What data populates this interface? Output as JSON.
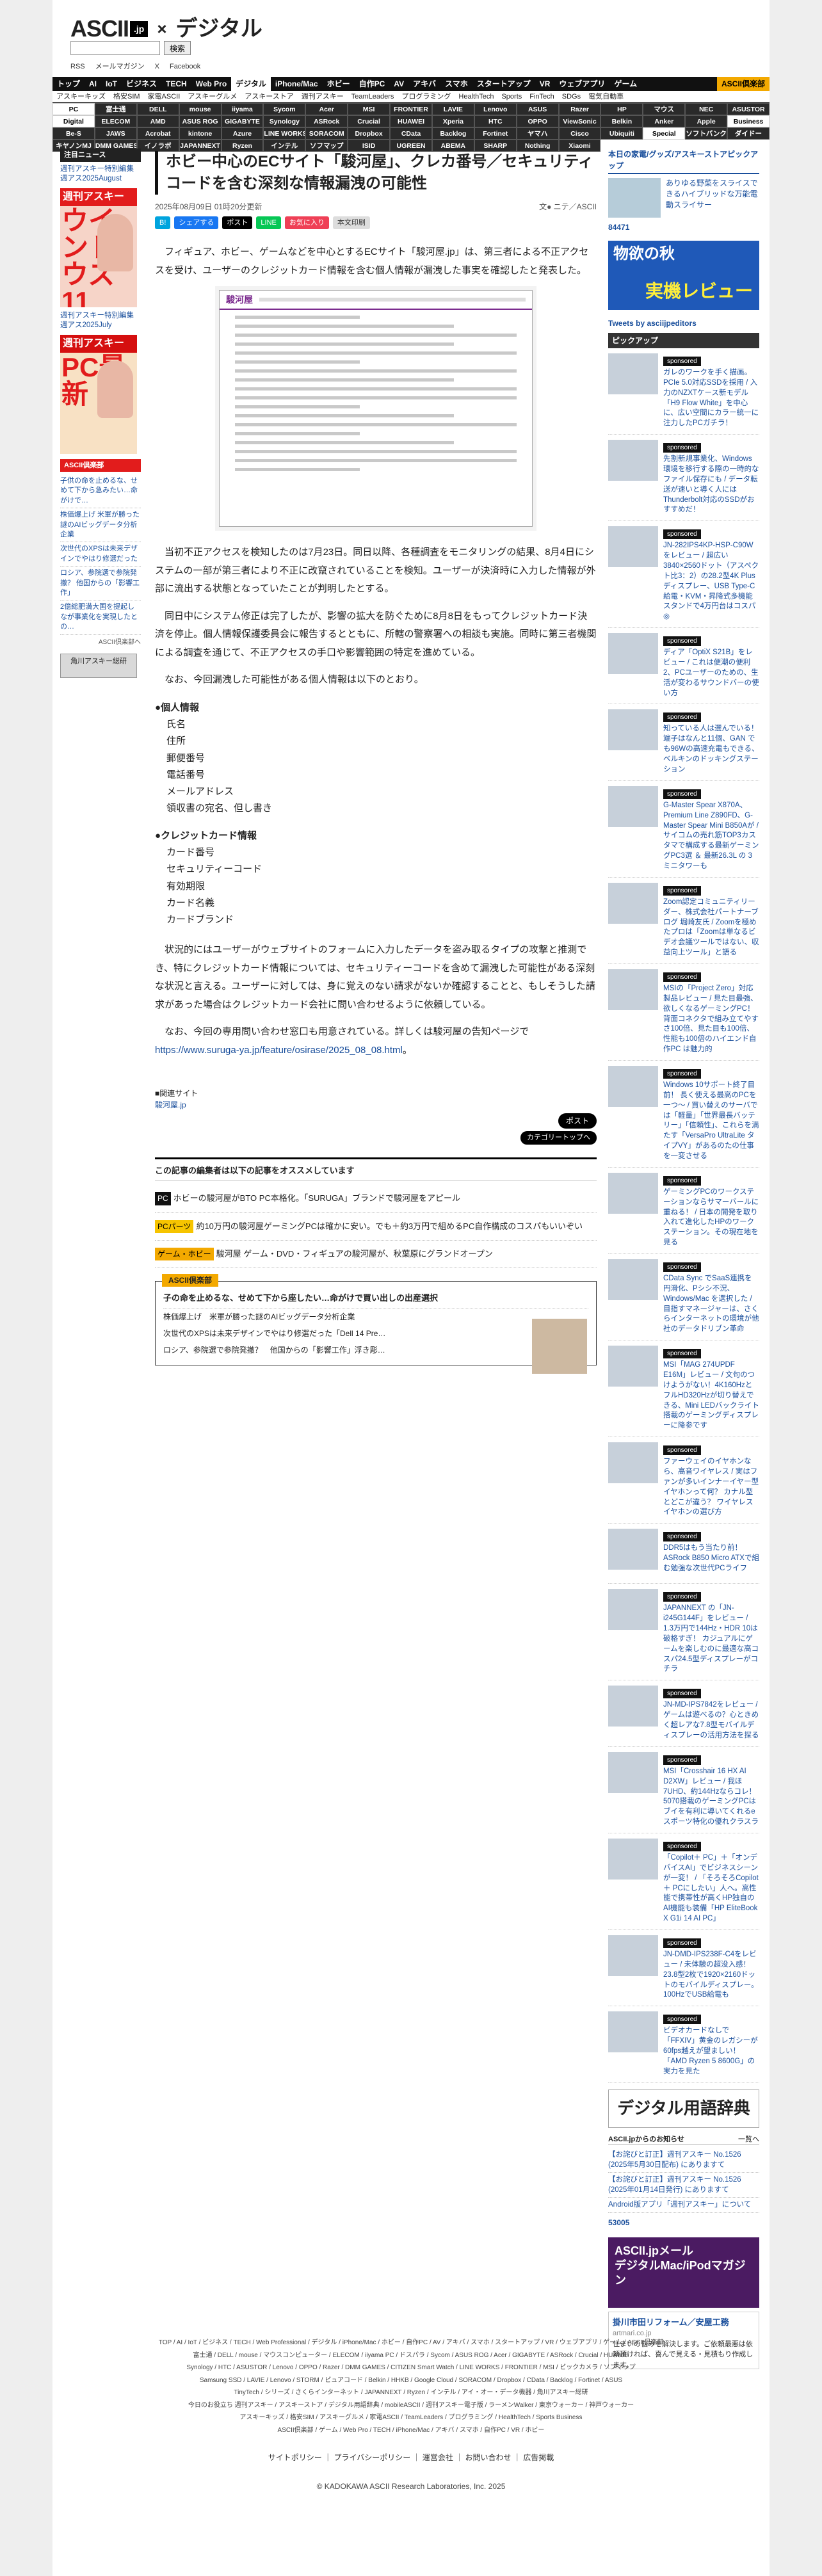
{
  "header": {
    "logo_ascii": "ASCII",
    "logo_jp": ".jp",
    "logo_x": "×",
    "logo_digital": "デジタル",
    "search_button": "検索",
    "sub_links": [
      "RSS",
      "メールマガジン",
      "X",
      "Facebook"
    ]
  },
  "nav": {
    "primary": [
      "トップ",
      "AI",
      "IoT",
      "ビジネス",
      "TECH",
      "Web Pro",
      "デジタル",
      "iPhone/Mac",
      "ホビー",
      "自作PC",
      "AV",
      "アキバ",
      "スマホ",
      "スタートアップ",
      "VR",
      "ウェブアプリ",
      "ゲーム"
    ],
    "active": "デジタル",
    "club_label": "ASCII倶楽部",
    "secondary": [
      "アスキーキッズ",
      "格安SIM",
      "家電ASCII",
      "アスキーグルメ",
      "アスキーストア",
      "週刊アスキー",
      "TeamLeaders",
      "プログラミング",
      "HealthTech",
      "Sports",
      "FinTech",
      "SDGs",
      "電気自動車"
    ],
    "grid": [
      "PC",
      "富士通",
      "DELL",
      "mouse",
      "iiyama",
      "Sycom",
      "Acer",
      "MSI",
      "FRONTIER",
      "LAVIE",
      "Lenovo",
      "ASUS",
      "Razer",
      "HP",
      "マウス",
      "NEC",
      "ASUSTOR",
      "Digital",
      "ELECOM",
      "AMD",
      "ASUS ROG",
      "GIGABYTE",
      "Synology",
      "ASRock",
      "Crucial",
      "HUAWEI",
      "Xperia",
      "HTC",
      "OPPO",
      "ViewSonic",
      "Belkin",
      "Anker",
      "Apple",
      "Business",
      "Be-S",
      "JAWS",
      "Acrobat",
      "kintone",
      "Azure",
      "LINE WORKS",
      "SORACOM",
      "Dropbox",
      "CData",
      "Backlog",
      "Fortinet",
      "ヤマハ",
      "Cisco",
      "Ubiquiti",
      "Special",
      "ソフトバンク",
      "ダイドー",
      "キヤノンMJ",
      "DMM GAMES",
      "イノラボ",
      "JAPANNEXT",
      "Ryzen",
      "インテル",
      "ソフマップ",
      "ISID",
      "UGREEN",
      "ABEMA",
      "SHARP",
      "Nothing",
      "Xiaomi"
    ]
  },
  "left": {
    "header": "注目ニュース",
    "links": [
      "週刊アスキー特別編集 週アス2025August",
      "週刊アスキー特別編集 週アス2025July"
    ],
    "mag1_title": "週刊アスキー",
    "mag1_big": "ウインドウズ11",
    "mag2_title": "週刊アスキー",
    "mag2_big": "PC最新",
    "club_header": "ASCII倶楽部",
    "club_links": [
      "子供の命を止めるな、せめて下から急みたい…命がけで…",
      "株価爆上げ 米軍が勝った謎のAIビッグデータ分析企業",
      "次世代のXPSは未来デザインでやはり修選だった",
      "ロシア、参院選で参院発撤？ 他国からの「影響工作」",
      "2億総肥満大国を提起しなが事業化を実現したとの…"
    ],
    "club_more": "ASCII倶楽部へ",
    "banner": "角川アスキー総研"
  },
  "article": {
    "title": "ホビー中心のECサイト「駿河屋」、クレカ番号／セキュリティコードを含む深刻な情報漏洩の可能性",
    "date": "2025年08月09日 01時20分更新",
    "author": "文● ニテ／ASCII",
    "share_fb": "シェアする",
    "share_x": "ポスト",
    "share_hatena": "B!",
    "share_pocket": "お気に入り",
    "share_text": "本文印刷",
    "p1": "フィギュア、ホビー、ゲームなどを中心とするECサイト「駿河屋.jp」は、第三者による不正アクセスを受け、ユーザーのクレジットカード情報を含む個人情報が漏洩した事実を確認したと発表した。",
    "figure_logo": "駿河屋",
    "p2": "当初不正アクセスを検知したのは7月23日。同日以降、各種調査をモニタリングの結果、8月4日にシステムの一部が第三者により不正に改竄されていることを検知。ユーザーが決済時に入力した情報が外部に流出する状態となっていたことが判明したとする。",
    "p3": "同日中にシステム修正は完了したが、影響の拡大を防ぐために8月8日をもってクレジットカード決済を停止。個人情報保護委員会に報告するとともに、所轄の警察署への相談も実施。同時に第三者機関による調査を通じて、不正アクセスの手口や影響範囲の特定を進めている。",
    "p4": "なお、今回漏洩した可能性がある個人情報は以下のとおり。",
    "sec1": "●個人情報",
    "sec1_items": [
      "氏名",
      "住所",
      "郵便番号",
      "電話番号",
      "メールアドレス",
      "領収書の宛名、但し書き"
    ],
    "sec2": "●クレジットカード情報",
    "sec2_items": [
      "カード番号",
      "セキュリティーコード",
      "有効期限",
      "カード名義",
      "カードブランド"
    ],
    "p5": "状況的にはユーザーがウェブサイトのフォームに入力したデータを盗み取るタイプの攻撃と推測でき、特にクレジットカード情報については、セキュリティーコードを含めて漏洩した可能性がある深刻な状況と言える。ユーザーに対しては、身に覚えのない請求がないか確認することと、もしそうした請求があった場合はクレジットカード会社に問い合わせるように依頼している。",
    "p6_pre": "なお、今回の専用問い合わせ窓口も用意されている。詳しくは駿河屋の告知ページで",
    "p6_url": "https://www.suruga-ya.jp/feature/osirase/2025_08_08.html",
    "p6_post": "。",
    "related_label": "■関連サイト",
    "related_link": "駿河屋.jp",
    "btn_x": "ポスト",
    "btn_category": "カテゴリートップへ"
  },
  "recommend": {
    "header": "この記事の編集者は以下の記事をオススメしています",
    "items": [
      {
        "tag": "PC",
        "text": "ホビーの駿河屋がBTO PC本格化。「SURUGA」ブランドで駿河屋をアピール"
      },
      {
        "tag": "PCパーツ",
        "text": "約10万円の駿河屋ゲーミングPCは確かに安い。でも＋約3万円で組めるPC自作構成のコスパもいいぞい"
      },
      {
        "tag": "ゲーム・ホビー",
        "text": "駿河屋 ゲーム・DVD・フィギュアの駿河屋が、秋葉原にグランドオープン"
      }
    ]
  },
  "club_box": {
    "head": "ASCII倶楽部",
    "top": "子の命を止めるな、せめて下から座したい…命がけで買い出しの出産選択",
    "items": [
      "株価爆上げ　米軍が勝った謎のAIビッグデータ分析企業",
      "次世代のXPSは未来デザインでやはり修選だった「Dell 14 Pre…",
      "ロシア、参院選で参院発撤？　他国からの「影響工作」浮き彫…"
    ]
  },
  "right": {
    "top_title": "本日の家電/グッズ/アスキーストアピックアップ",
    "hero_text": "ありゆる野菜をスライスできるハイブリッドな万能電動スライサー",
    "hero_code": "84471",
    "banner_l1": "物欲の秋",
    "banner_l2": "実機レビュー",
    "tweets": "Tweets by asciijpeditors",
    "pickup": "ピックアップ",
    "sponsored": "sponsored",
    "pickups": [
      "ガレのワークを手く描画。PCIe 5.0対応SSDを採用 / 入力のNZXTケース新モデル「H9 Flow White」を中心に、広い空間にカラー統一に注力したPCガチラ！",
      "先割新規事業化、Windows環境を移行する際の一時的なファイル保存にも / データ転送が速いと導く人には Thunderbolt対応のSSDがおすすめだ！",
      "JN-282IPS4KP-HSP-C90Wをレビュー / 超広い3840×2560ドット（アスペクト比3：2）の28.2型4K Plusディスプレー、USB Type-C給電・KVM・昇降式多機能スタンドで4万円台はコスパ◎",
      "ディア「OptiX S21B」をレビュー / これは便潮の便利2、PCユーザーのための、生活が変わるサウンドバーの使い方",
      "知っている人は選んでいる！ 端子はなんと11個、GAN でも96Wの高速充電もできる、ベルキンのドッキングステーション",
      "G-Master Spear X870A、Premium Line Z890FD、G-Master Spear Mini B850Aが / サイコムの売れ筋TOP3カスタマで構成する最新ゲーミングPC3選 ＆ 最新26.3L の 3 ミニタワーも",
      "Zoom認定コミュニティリーダー、株式会社パートナーブログ 堀崎友氏 / Zoomを極めたプロは「Zoomは単なるビデオ会議ツールではない、収益向上ツール」と語る",
      "MSIの「Project Zero」対応製品レビュー / 見た目最強、欲しくなるゲーミングPC！背面コネクタで組み立てやすさ100倍、見た目も100倍、性能も100倍のハイエンド自作PC は魅力的",
      "Windows 10サポート終了目前！ 長く使える最高のPCを一つ〜 / 買い替えのサーバでは「軽量」「世界最長バッテリー」「信頼性」、これらを満たす「VersaPro UltraLite タイプVY」があるのたの仕事を一変させる",
      "ゲーミングPCのワークステーションならサマーバールに重ねる！ / 日本の開発を取り入れて進化したHPのワークステーション。その現在地を見る",
      "CData Sync でSaaS連携を円滑化、Pシシ不況、Windows/Mac を選択した / 目指すマネージャーは、さくらインターネットの環境が他社のデータドリブン革命",
      "MSI「MAG 274UPDF E16M」レビュー / 文句のつけようがない！4K160HzとフルHD320Hzが切り替えできる、Mini LEDバックライト搭載のゲーミングディスプレーに降参です",
      "ファーウェイのイヤホンなら、高音ワイヤレス / 実はファンが多いインナーイヤー型イヤホンって何？ カナル型とどこが違う？ ワイヤレスイヤホンの選び方",
      "DDR5はもう当たり前！ ASRock B850 Micro ATXで組む勉強な次世代PCライフ",
      "JAPANNEXT の「JN-i245G144F」をレビュー / 1.3万円で144Hz・HDR 10は破格すぎ！ カジュアルにゲームを楽しむのに最適な高コスパ24.5型ディスプレーがコチラ",
      "JN-MD-IPS7842をレビュー / ゲームは遊べるの？心ときめく超レアな7.8型モバイルディスプレーの活用方法を探る",
      "MSI「Crosshair 16 HX AI D2XW」レビュー / 我ほ7UHD、約144Hzならコレ！5070搭載のゲーミングPCはブイを有利に導いてくれるeスポーツ特化の優れクラスラ",
      "「Copilot＋ PC」＋「オンデバイスAI」でビジネスシーンが一変！ / 「そろそろCopilot＋ PCにしたい」人へ。高性能で携帯性が高くHP独自のAI機能も装備「HP EliteBook X G1i 14 AI PC」",
      "JN-DMD-IPS238F-C4をレビュー / 未体験の超没入感！23.8型2枚で1920×2160ドットのモバイルディスプレー。100HzでUSB給電も",
      "ビデオカードなしで「FFXIV」黄金のレガシーが60fps越えが望ましい！「AMD Ryzen 5 8600G」の実力を見た"
    ],
    "dict_title": "デジタル用語辞典",
    "links_header": "ASCII.jpからのお知らせ",
    "links_more": "一覧へ",
    "links": [
      "【お詫びと訂正】週刊アスキー No.1526 (2025年5月30日配布) にありますて",
      "【お詫びと訂正】週刊アスキー No.1526 (2025年01月14日発行) にありますて",
      "Android版アプリ「週刊アスキー」について"
    ],
    "code2": "53005",
    "mail_l1": "ASCII.jpメール",
    "mail_l2": "デジタルMac/iPodマガジン",
    "ad_title": "掛川市田リフォーム／安屋工務",
    "ad_sub": "artmari.co.jp",
    "ad_text": "住まいの悩みを解決します。ご依頼最悪は依頼頂ければ、喜んで見える・見積もり作成します。"
  },
  "footer": {
    "lines": [
      "TOP / AI / IoT / ビジネス / TECH / Web Professional / デジタル / iPhone/Mac / ホビー / 自作PC / AV / アキバ / スマホ / スタートアップ / VR / ウェブアプリ / ゲーム / ASCII倶楽部",
      "富士通 / DELL / mouse / マウスコンピューター / ELECOM / iiyama PC / ドスパラ / Sycom / ASUS ROG / Acer / GIGABYTE / ASRock / Crucial / HUAWEI",
      "Synology / HTC / ASUSTOR / Lenovo / OPPO / Razer / DMM GAMES / CITIZEN Smart Watch / LINE WORKS / FRONTIER / MSI / ビックカメラ / ソフマップ",
      "Samsung SSD / LAVIE / Lenovo / STORM / ピュアコード / Belkin / HHKB / Google Cloud / SORACOM / Dropbox / CData / Backlog / Fortinet / ASUS",
      "TinyTech / シリーズ / さくらインターネット / JAPANNEXT / Ryzen / インテル / アイ・オー・データ機器 / 角川アスキー総研",
      "今日のお役立ち 週刊アスキー / アスキーストア / デジタル用語辞典 / mobileASCII / 週刊アスキー電子版 / ラーメンWalker / 東京ウォーカー / 神戸ウォーカー",
      "アスキーキッズ / 格安SIM / アスキーグルメ / 家電ASCII / TeamLeaders / プログラミング / HealthTech / Sports Business",
      "ASCII倶楽部 / ゲーム / Web Pro / TECH / iPhone/Mac / アキバ / スマホ / 自作PC / VR / ホビー"
    ],
    "links": "サイトポリシー ｜ プライバシーポリシー ｜ 運営会社 ｜ お問い合わせ ｜ 広告掲載",
    "copyright": "© KADOKAWA ASCII Research Laboratories, Inc. 2025"
  }
}
